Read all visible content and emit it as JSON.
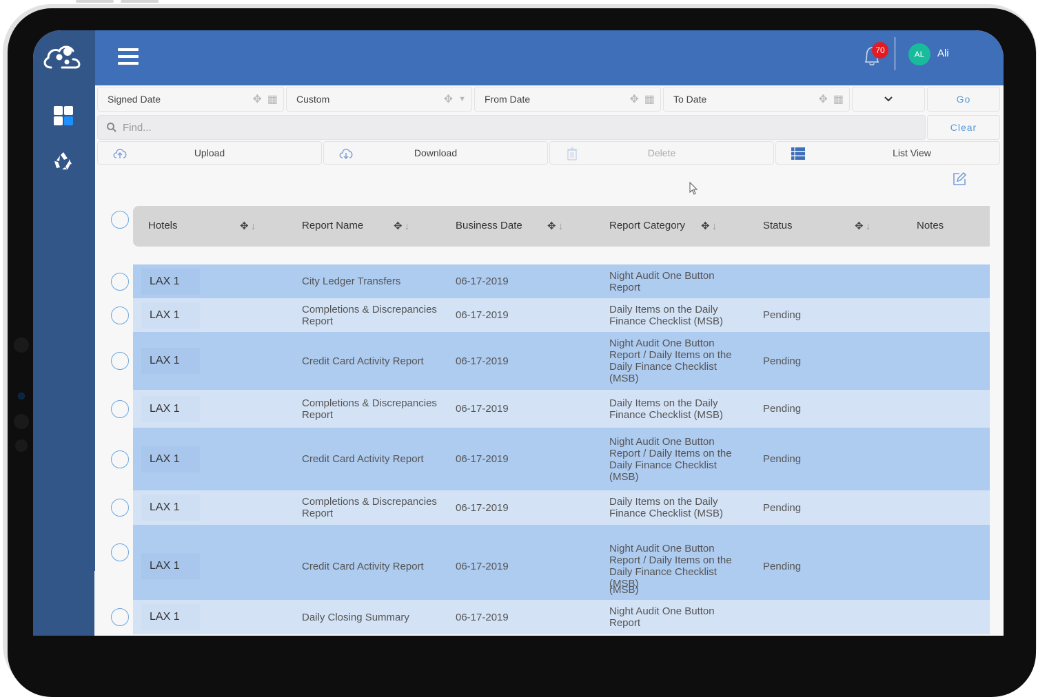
{
  "header": {
    "notification_count": "70",
    "user_initials": "AL",
    "user_name": "Ali"
  },
  "filters": {
    "signed_date": "Signed Date",
    "custom": "Custom",
    "from_date": "From Date",
    "to_date": "To Date",
    "go": "Go",
    "clear": "Clear"
  },
  "search": {
    "placeholder": "Find..."
  },
  "actions": {
    "upload": "Upload",
    "download": "Download",
    "delete": "Delete",
    "list_view": "List View"
  },
  "table": {
    "columns": [
      "Hotels",
      "Report Name",
      "Business Date",
      "Report Category",
      "Status",
      "Notes"
    ],
    "rows": [
      {
        "hotel": "LAX 1",
        "report_name": "City Ledger Transfers",
        "business_date": "06-17-2019",
        "category": "Night Audit One Button Report",
        "status": "",
        "notes": ""
      },
      {
        "hotel": "LAX 1",
        "report_name": "Completions & Discrepancies Report",
        "business_date": "06-17-2019",
        "category": "Daily Items on the Daily Finance Checklist (MSB)",
        "status": "Pending",
        "notes": ""
      },
      {
        "hotel": "LAX 1",
        "report_name": "Credit Card Activity Report",
        "business_date": "06-17-2019",
        "category": "Night Audit One Button Report / Daily Items on the Daily Finance Checklist (MSB)",
        "status": "Pending",
        "notes": ""
      },
      {
        "hotel": "LAX 1",
        "report_name": "Completions & Discrepancies Report",
        "business_date": "06-17-2019",
        "category": "Daily Items on the Daily Finance Checklist (MSB)",
        "status": "Pending",
        "notes": ""
      },
      {
        "hotel": "LAX 1",
        "report_name": "Credit Card Activity Report",
        "business_date": "06-17-2019",
        "category": "Night Audit One Button Report / Daily Items on the Daily Finance Checklist (MSB)",
        "status": "Pending",
        "notes": ""
      },
      {
        "hotel": "LAX 1",
        "report_name": "Completions & Discrepancies Report",
        "business_date": "06-17-2019",
        "category": "Daily Items on the Daily Finance Checklist (MSB)",
        "status": "Pending",
        "notes": ""
      },
      {
        "hotel": "LAX 1",
        "report_name": "Credit Card Activity Report",
        "business_date": "06-17-2019",
        "category": "Night Audit One Button Report / Daily Items on the Daily Finance Checklist (MSB)",
        "status": "Pending",
        "notes": "",
        "extra": "(MSB)"
      },
      {
        "hotel": "LAX 1",
        "report_name": "Daily Closing Summary",
        "business_date": "06-17-2019",
        "category": "Night Audit One Button Report",
        "status": "",
        "notes": ""
      }
    ]
  }
}
